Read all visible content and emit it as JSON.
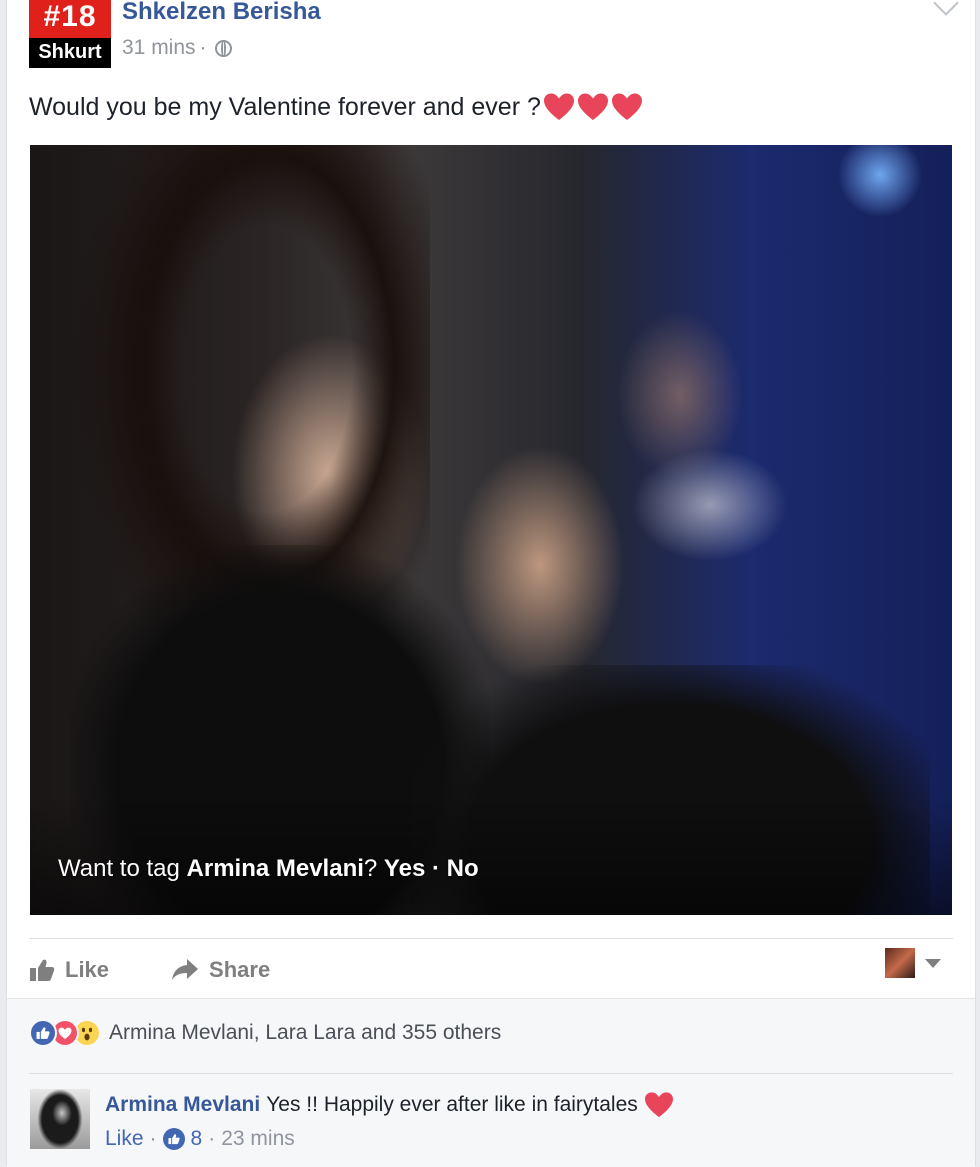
{
  "post": {
    "page_badge_top": "#18",
    "page_badge_bottom": "Shkurt",
    "author": "Shkelzen Berisha",
    "time": "31 mins",
    "meta_sep": "·",
    "privacy_icon": "globe-icon",
    "text": "Would you be my Valentine forever and ever ?",
    "hearts": [
      "heart-icon",
      "heart-icon",
      "heart-icon"
    ],
    "photo": {
      "tag_prefix": "Want to tag ",
      "tag_name": "Armina Mevlani",
      "tag_suffix": "? ",
      "yes_label": "Yes",
      "tag_sep": " · ",
      "no_label": "No"
    }
  },
  "actions": {
    "like_label": "Like",
    "share_label": "Share"
  },
  "reactions": {
    "icons": [
      "like-reaction-icon",
      "love-reaction-icon",
      "wow-reaction-icon"
    ],
    "summary": "Armina Mevlani, Lara Lara and 355 others"
  },
  "comment": {
    "author": "Armina Mevlani",
    "text": "Yes !! Happily ever after like in fairytales",
    "like_label": "Like",
    "sep": "·",
    "like_count": "8",
    "time": "23 mins"
  },
  "colors": {
    "link": "#365899",
    "like_blue": "#4267b2",
    "love_red": "#f25268",
    "heart_red": "#e8455a",
    "wow_yellow": "#fcd453",
    "badge_red": "#e0201b"
  }
}
